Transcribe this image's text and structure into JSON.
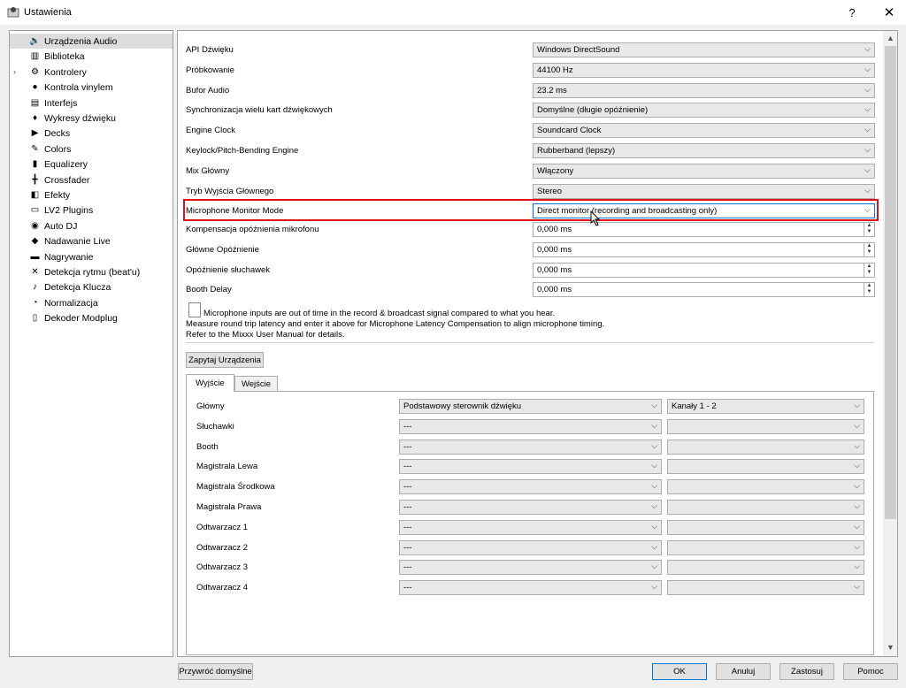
{
  "window": {
    "title": "Ustawienia",
    "help_label": "?",
    "close_label": "✕"
  },
  "sidebar": {
    "items": [
      {
        "label": "Urządzenia Audio",
        "icon": "speaker-icon"
      },
      {
        "label": "Biblioteka",
        "icon": "library-icon"
      },
      {
        "label": "Kontrolery",
        "icon": "controller-icon"
      },
      {
        "label": "Kontrola vinylem",
        "icon": "vinyl-icon"
      },
      {
        "label": "Interfejs",
        "icon": "interface-icon"
      },
      {
        "label": "Wykresy dźwięku",
        "icon": "waveform-icon"
      },
      {
        "label": "Decks",
        "icon": "play-icon"
      },
      {
        "label": "Colors",
        "icon": "palette-icon"
      },
      {
        "label": "Equalizery",
        "icon": "equalizer-icon"
      },
      {
        "label": "Crossfader",
        "icon": "crossfader-icon"
      },
      {
        "label": "Efekty",
        "icon": "effects-icon"
      },
      {
        "label": "LV2 Plugins",
        "icon": "lv2-icon"
      },
      {
        "label": "Auto DJ",
        "icon": "autodj-icon"
      },
      {
        "label": "Nadawanie Live",
        "icon": "broadcast-icon"
      },
      {
        "label": "Nagrywanie",
        "icon": "recording-icon"
      },
      {
        "label": "Detekcja rytmu (beat'u)",
        "icon": "beat-icon"
      },
      {
        "label": "Detekcja Klucza",
        "icon": "key-icon"
      },
      {
        "label": "Normalizacja",
        "icon": "normalize-icon"
      },
      {
        "label": "Dekoder Modplug",
        "icon": "modplug-icon"
      }
    ]
  },
  "settings": [
    {
      "label": "API Dźwięku",
      "value": "Windows DirectSound"
    },
    {
      "label": "Próbkowanie",
      "value": "44100 Hz"
    },
    {
      "label": "Bufor Audio",
      "value": "23.2 ms"
    },
    {
      "label": "Synchronizacja wielu kart dźwiękowych",
      "value": "Domyślne (długie opóźnienie)"
    },
    {
      "label": "Engine Clock",
      "value": "Soundcard Clock"
    },
    {
      "label": "Keylock/Pitch-Bending Engine",
      "value": "Rubberband (lepszy)"
    },
    {
      "label": "Mix Główny",
      "value": "Włączony"
    },
    {
      "label": "Tryb Wyjścia Głównego",
      "value": "Stereo"
    },
    {
      "label": "Microphone Monitor Mode",
      "value": "Direct monitor (recording and broadcasting only)"
    }
  ],
  "spinboxes": [
    {
      "label": "Kompensacja opóźnienia mikrofonu",
      "value": "0,000 ms"
    },
    {
      "label": "Główne Opóźnienie",
      "value": "0,000 ms"
    },
    {
      "label": "Opóźnienie słuchawek",
      "value": "0,000 ms"
    },
    {
      "label": "Booth Delay",
      "value": "0,000 ms"
    }
  ],
  "info": {
    "line1": "Microphone inputs are out of time in the record & broadcast signal compared to what you hear.",
    "line2": "Measure round trip latency and enter it above for Microphone Latency Compensation to align microphone timing.",
    "line3": "Refer to the Mixxx User Manual for details."
  },
  "query_button": "Zapytaj Urządzenia",
  "tabs": {
    "output": "Wyjście",
    "input": "Wejście"
  },
  "outputs": [
    {
      "label": "Główny",
      "device": "Podstawowy sterownik dźwięku",
      "channels": "Kanały 1 - 2"
    },
    {
      "label": "Słuchawki",
      "device": "---",
      "channels": ""
    },
    {
      "label": "Booth",
      "device": "---",
      "channels": ""
    },
    {
      "label": "Magistrala Lewa",
      "device": "---",
      "channels": ""
    },
    {
      "label": "Magistrala Środkowa",
      "device": "---",
      "channels": ""
    },
    {
      "label": "Magistrala Prawa",
      "device": "---",
      "channels": ""
    },
    {
      "label": "Odtwarzacz 1",
      "device": "---",
      "channels": ""
    },
    {
      "label": "Odtwarzacz 2",
      "device": "---",
      "channels": ""
    },
    {
      "label": "Odtwarzacz 3",
      "device": "---",
      "channels": ""
    },
    {
      "label": "Odtwarzacz 4",
      "device": "---",
      "channels": ""
    }
  ],
  "footer": {
    "reset": "Przywróć domyślne",
    "ok": "OK",
    "cancel": "Anuluj",
    "apply": "Zastosuj",
    "help": "Pomoc"
  },
  "colors": {
    "highlight": "#e0101a",
    "focus": "#0078d7"
  }
}
